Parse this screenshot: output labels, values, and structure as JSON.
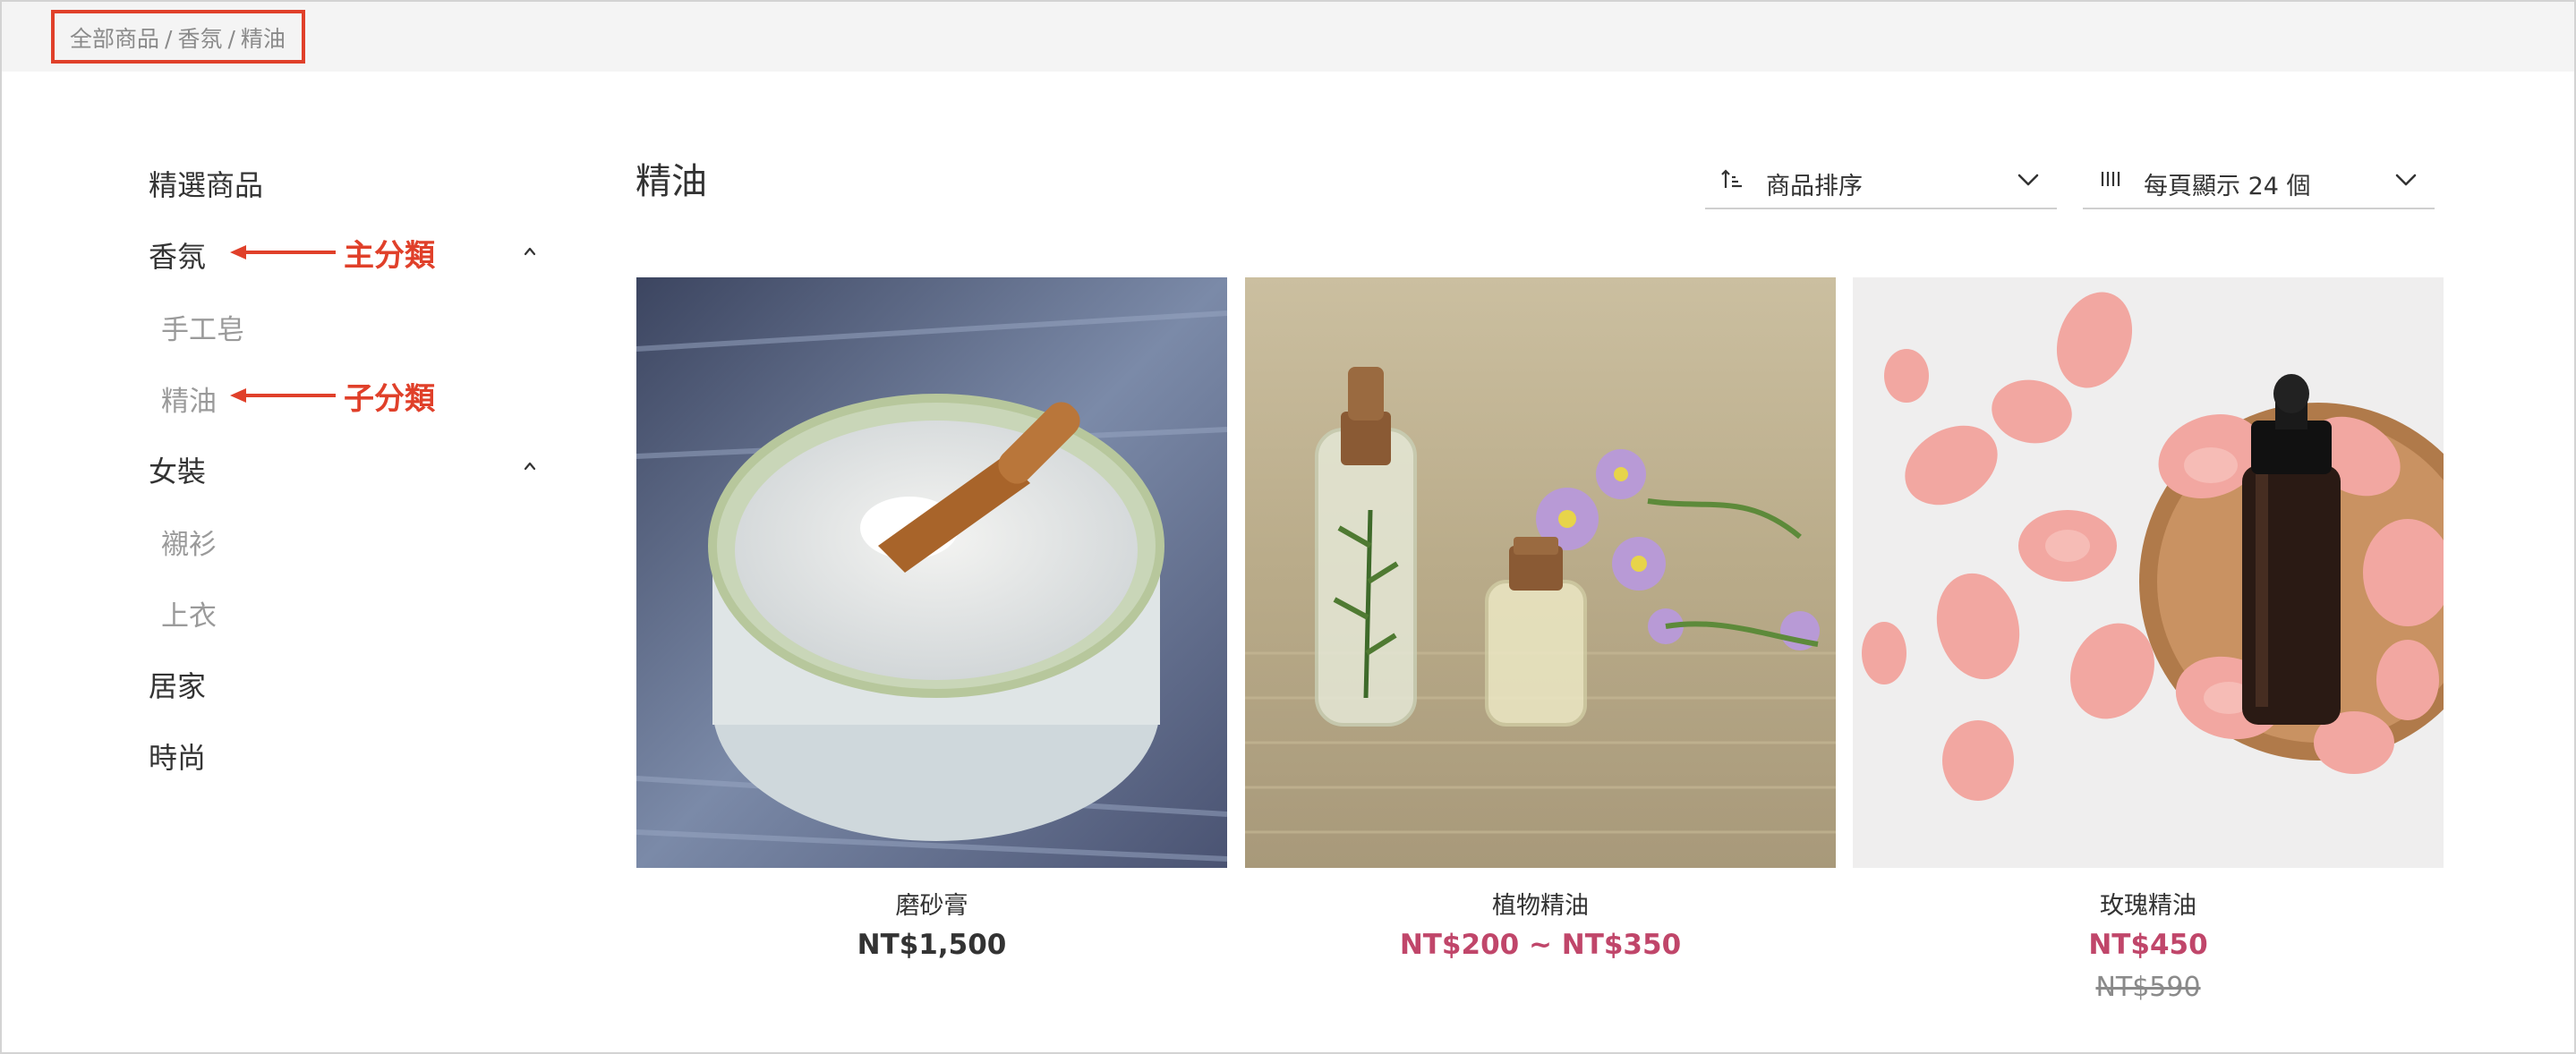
{
  "breadcrumb": {
    "items": [
      "全部商品",
      "香氛",
      "精油"
    ],
    "separator": "/"
  },
  "sidebar": {
    "items": [
      {
        "label": "精選商品"
      },
      {
        "label": "香氛",
        "expanded": true,
        "children": [
          {
            "label": "手工皂"
          },
          {
            "label": "精油"
          }
        ]
      },
      {
        "label": "女裝",
        "expanded": true,
        "children": [
          {
            "label": "襯衫"
          },
          {
            "label": "上衣"
          }
        ]
      },
      {
        "label": "居家"
      },
      {
        "label": "時尚"
      }
    ]
  },
  "annotations": {
    "main_category": "主分類",
    "sub_category": "子分類",
    "color": "#e0402a"
  },
  "main": {
    "title": "精油",
    "sort": {
      "label": "商品排序",
      "icon": "sort-ascending-icon"
    },
    "per_page": {
      "label": "每頁顯示 24 個",
      "icon": "columns-icon"
    }
  },
  "products": [
    {
      "name": "磨砂膏",
      "price": "NT$1,500",
      "on_sale": false,
      "image": "scrub-jar-photo"
    },
    {
      "name": "植物精油",
      "price": "NT$200 ~ NT$350",
      "on_sale": true,
      "image": "herbal-oil-bottles-photo"
    },
    {
      "name": "玫瑰精油",
      "price": "NT$450",
      "original_price": "NT$590",
      "on_sale": true,
      "image": "rose-oil-bottle-photo"
    }
  ],
  "colors": {
    "sale_price": "#c0466a",
    "annotation": "#e0402a",
    "breadcrumb_bg": "#f4f4f4"
  }
}
